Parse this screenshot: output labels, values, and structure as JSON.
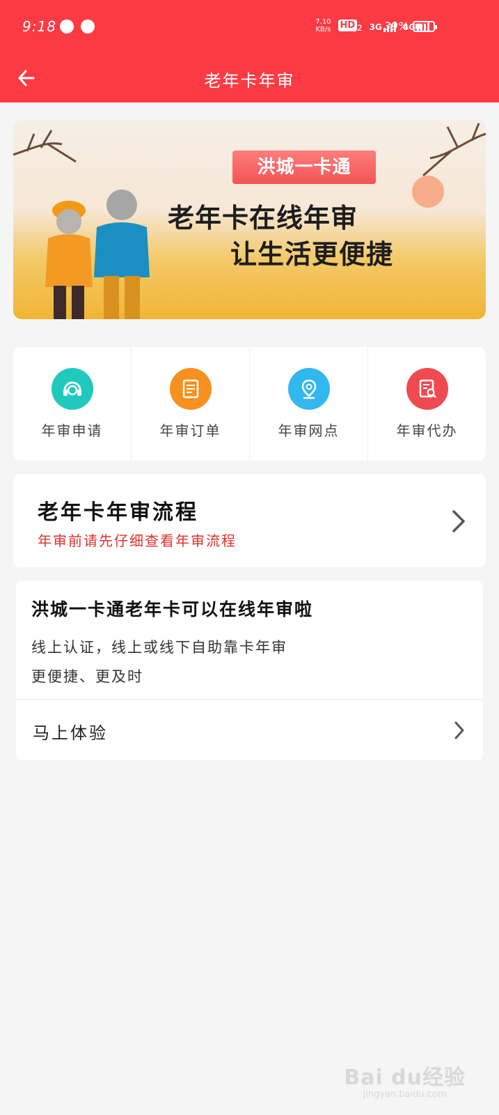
{
  "status_bar": {
    "time": "9:18",
    "net_speed_value": "7.10",
    "net_speed_unit": "KB/s",
    "hd_label": "HD",
    "hd_sub": "2",
    "sig1_label": "3G",
    "sig2_label": "4G",
    "battery_pct": "39%"
  },
  "header": {
    "title": "老年卡年审"
  },
  "banner": {
    "ribbon": "洪城一卡通",
    "line1": "老年卡在线年审",
    "line2": "让生活更便捷"
  },
  "quick_actions": [
    {
      "label": "年审申请",
      "color": "#21c9bd",
      "icon": "headset-icon"
    },
    {
      "label": "年审订单",
      "color": "#f7901e",
      "icon": "document-icon"
    },
    {
      "label": "年审网点",
      "color": "#33b7ef",
      "icon": "location-pin-icon"
    },
    {
      "label": "年审代办",
      "color": "#ef4a4f",
      "icon": "search-document-icon"
    }
  ],
  "flow_card": {
    "title": "老年卡年审流程",
    "subtitle": "年审前请先仔细查看年审流程"
  },
  "promo_card": {
    "title": "洪城一卡通老年卡可以在线年审啦",
    "line1": "线上认证，线上或线下自助靠卡年审",
    "line2": "更便捷、更及时",
    "cta": "马上体验"
  },
  "watermark": {
    "brand": "Bai du经验",
    "url": "jingyan.baidu.com"
  },
  "colors": {
    "primary": "#fc3a44",
    "accent_text": "#e0312c"
  }
}
